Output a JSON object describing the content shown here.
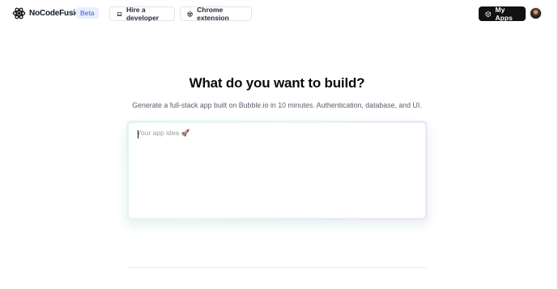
{
  "header": {
    "brand": "NoCodeFusion",
    "badge": "Beta",
    "hire_label": "Hire a developer",
    "chrome_label": "Chrome extension",
    "my_apps_label": "My Apps"
  },
  "hero": {
    "title": "What do you want to build?",
    "subtitle": "Generate a full-stack app built on Bubble.io in 10 minutes. Authentication, database, and UI."
  },
  "prompt": {
    "placeholder": "Your app idea 🚀",
    "value": ""
  },
  "icons": {
    "logo": "atom-logo-icon",
    "hire": "laptop-icon",
    "chrome": "chrome-icon",
    "my_apps": "box-icon"
  },
  "colors": {
    "accent_dark": "#111111",
    "badge_bg": "#e8efff",
    "badge_text": "#3b5bcc"
  }
}
